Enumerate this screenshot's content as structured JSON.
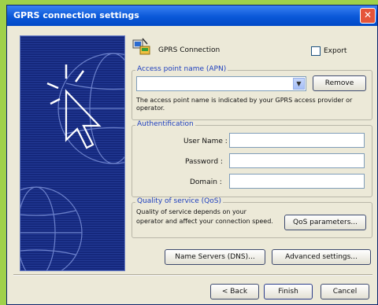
{
  "window": {
    "title": "GPRS connection settings"
  },
  "header": {
    "connection_label": "GPRS Connection",
    "export_label": "Export",
    "export_checked": false
  },
  "apn": {
    "group_label": "Access point name (APN)",
    "value": "",
    "remove_label": "Remove",
    "help_line1": "The access point name is indicated by your GPRS access provider or",
    "help_line2": "operator."
  },
  "auth": {
    "group_label": "Authentification",
    "username_label": "User Name :",
    "password_label": "Password :",
    "domain_label": "Domain :",
    "username_value": "",
    "password_value": "",
    "domain_value": ""
  },
  "qos": {
    "group_label": "Quality of service (QoS)",
    "desc_line1": "Quality of service depends on your",
    "desc_line2": "operator and affect your connection speed.",
    "button_label": "QoS parameters..."
  },
  "actions": {
    "name_servers": "Name Servers (DNS)...",
    "advanced": "Advanced settings..."
  },
  "footer": {
    "back": "< Back",
    "finish": "Finish",
    "cancel": "Cancel"
  },
  "icons": {
    "close": "close-icon",
    "connection": "gprs-connection-icon",
    "dropdown": "chevron-down-icon"
  }
}
